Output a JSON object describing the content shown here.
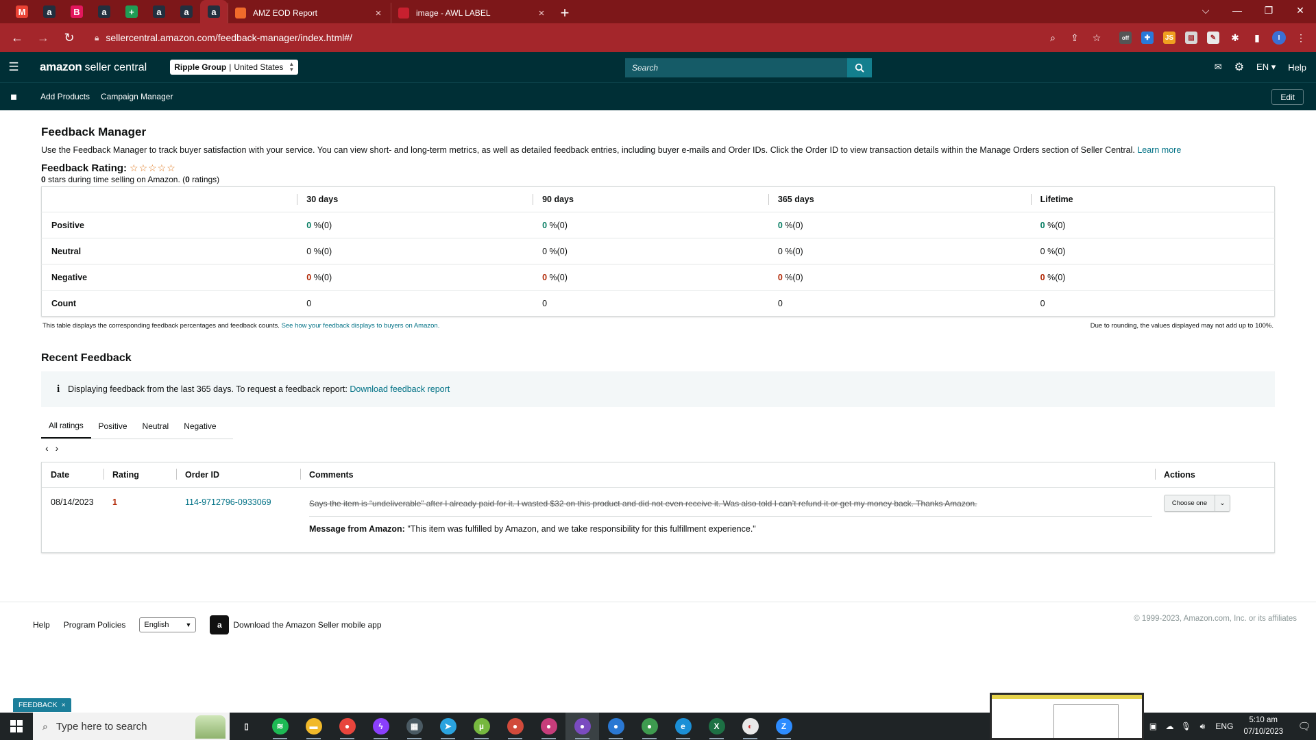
{
  "browser": {
    "pinned_tabs": [
      {
        "icon": "gmail-icon",
        "glyph": "M",
        "color": "#ea4335"
      },
      {
        "icon": "amazon-icon",
        "glyph": "a",
        "color": "#232f3e"
      },
      {
        "icon": "b-app-icon",
        "glyph": "B",
        "color": "#e3175d"
      },
      {
        "icon": "amazon-icon",
        "glyph": "a",
        "color": "#232f3e"
      },
      {
        "icon": "sheets-icon",
        "glyph": "+",
        "color": "#1f9d55"
      },
      {
        "icon": "amazon-icon",
        "glyph": "a",
        "color": "#232f3e"
      },
      {
        "icon": "amazon-icon",
        "glyph": "a",
        "color": "#232f3e"
      },
      {
        "icon": "amazon-icon",
        "glyph": "a",
        "color": "#232f3e"
      }
    ],
    "tabs": [
      {
        "title": "AMZ EOD Report",
        "icon": "eod-report-icon",
        "color": "#f06b2b"
      },
      {
        "title": "image - AWL LABEL",
        "icon": "awl-label-icon",
        "color": "#c8202f"
      }
    ],
    "url": "sellercentral.amazon.com/feedback-manager/index.html#/",
    "ext_js": "JS",
    "profile_initial": "I"
  },
  "header": {
    "logo_amazon": "amazon",
    "logo_rest": "seller central",
    "account_name": "Ripple Group",
    "account_sep": "|",
    "account_region": "United States",
    "search_placeholder": "Search",
    "lang": "EN",
    "help": "Help"
  },
  "nav": {
    "items": [
      "Add Products",
      "Campaign Manager"
    ],
    "edit": "Edit"
  },
  "page": {
    "title": "Feedback Manager",
    "description": "Use the Feedback Manager to track buyer satisfaction with your service. You can view short- and long-term metrics, as well as detailed feedback entries, including buyer e-mails and Order IDs. Click the Order ID to view transaction details within the Manage Orders section of Seller Central.",
    "learn_more": "Learn more",
    "rating_label": "Feedback Rating:",
    "rating_stars": "☆☆☆☆☆",
    "rating_value": "0",
    "rating_text_mid": " stars during time selling on Amazon. (",
    "rating_count": "0",
    "rating_text_end": " ratings)"
  },
  "metrics": {
    "columns": [
      "30 days",
      "90 days",
      "365 days",
      "Lifetime"
    ],
    "rows": [
      {
        "label": "Positive",
        "kind": "pos",
        "cells": [
          "0",
          "0",
          "0",
          "0"
        ],
        "suffix": " %(0)"
      },
      {
        "label": "Neutral",
        "kind": "neu",
        "cells": [
          "0",
          "0",
          "0",
          "0"
        ],
        "suffix": " %(0)"
      },
      {
        "label": "Negative",
        "kind": "neg",
        "cells": [
          "0",
          "0",
          "0",
          "0"
        ],
        "suffix": " %(0)"
      },
      {
        "label": "Count",
        "kind": "cnt",
        "cells": [
          "0",
          "0",
          "0",
          "0"
        ],
        "suffix": ""
      }
    ],
    "note_left": "This table displays the corresponding feedback percentages and feedback counts.",
    "note_link": "See how your feedback displays to buyers on Amazon.",
    "note_right": "Due to rounding, the values displayed may not add up to 100%."
  },
  "recent": {
    "title": "Recent Feedback",
    "info_icon": "i",
    "info_text": "Displaying feedback from the last 365 days. To request a feedback report:",
    "info_link": "Download feedback report",
    "tabs": [
      "All ratings",
      "Positive",
      "Neutral",
      "Negative"
    ],
    "columns": [
      "Date",
      "Rating",
      "Order ID",
      "Comments",
      "Actions"
    ],
    "rows": [
      {
        "date": "08/14/2023",
        "rating": "1",
        "order_id": "114-9712796-0933069",
        "comment": "Says the item is “undeliverable” after I already paid for it. I wasted $32 on this product and did not even receive it. Was also told I can’t refund it or get my money back. Thanks Amazon.",
        "message_label": "Message from Amazon:",
        "message": "\"This item was fulfilled by Amazon, and we take responsibility for this fulfillment experience.\"",
        "action": "Choose one"
      }
    ]
  },
  "footer": {
    "help": "Help",
    "policies": "Program Policies",
    "language": "English",
    "app_text": "Download the Amazon Seller mobile app",
    "copyright": "© 1999-2023, Amazon.com, Inc. or its affiliates"
  },
  "feedback_button": {
    "label": "FEEDBACK",
    "close": "×"
  },
  "taskbar": {
    "search_placeholder": "Type here to search",
    "apps": [
      {
        "name": "task-view-icon",
        "color": "#1f2426",
        "glyph": "▯"
      },
      {
        "name": "spotify-icon",
        "color": "#1db954",
        "glyph": "≋"
      },
      {
        "name": "file-explorer-icon",
        "color": "#f1b92a",
        "glyph": "▬"
      },
      {
        "name": "chrome-icon",
        "color": "#e8453c",
        "glyph": "●"
      },
      {
        "name": "messenger-icon",
        "color": "#8a3ffc",
        "glyph": "ϟ"
      },
      {
        "name": "calculator-icon",
        "color": "#4a5a63",
        "glyph": "▦"
      },
      {
        "name": "telegram-icon",
        "color": "#2aa3df",
        "glyph": "➤"
      },
      {
        "name": "utorrent-icon",
        "color": "#76b83f",
        "glyph": "µ"
      },
      {
        "name": "chrome-profile-icon",
        "color": "#d14a3b",
        "glyph": "●"
      },
      {
        "name": "chrome-profile-icon",
        "color": "#c63d7b",
        "glyph": "●"
      },
      {
        "name": "chrome-profile-icon",
        "color": "#7a4bc0",
        "glyph": "●"
      },
      {
        "name": "chrome-profile-icon",
        "color": "#2a78d3",
        "glyph": "●"
      },
      {
        "name": "chrome-profile-icon",
        "color": "#3e9b4f",
        "glyph": "●"
      },
      {
        "name": "edge-icon",
        "color": "#1b8fd6",
        "glyph": "e"
      },
      {
        "name": "excel-icon",
        "color": "#1d7044",
        "glyph": "X"
      },
      {
        "name": "paint-icon",
        "color": "#e9e9e9",
        "glyph": "◐"
      },
      {
        "name": "zoom-icon",
        "color": "#2d8cff",
        "glyph": "Z"
      }
    ],
    "lang": "ENG",
    "time": "5:10 am",
    "date": "07/10/2023"
  }
}
